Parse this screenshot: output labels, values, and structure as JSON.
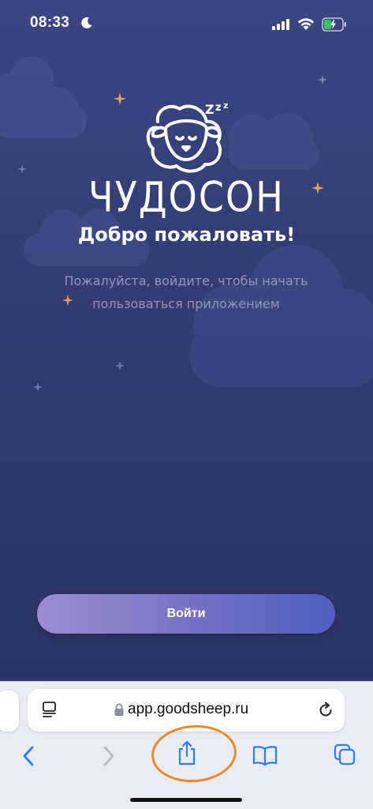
{
  "status_bar": {
    "time": "08:33"
  },
  "app": {
    "brand": "ЧУДОСОН",
    "welcome_title": "Добро пожаловать!",
    "subtitle": "Пожалуйста, войдите, чтобы начать пользоваться приложением",
    "login_button": "Войти"
  },
  "browser": {
    "url": "app.goodsheep.ru",
    "toolbar": {
      "back": "chevron-left-icon",
      "forward": "chevron-right-icon",
      "share": "share-icon",
      "bookmarks": "book-icon",
      "tabs": "tabs-icon"
    }
  },
  "colors": {
    "background_top": "#3b4682",
    "background_bottom": "#293263",
    "accent_sparkle": "#e8a05a",
    "button_gradient_start": "#9c8ed0",
    "button_gradient_end": "#4f5ec0",
    "safari_blue": "#2f7df6",
    "highlight": "#f0892e"
  }
}
